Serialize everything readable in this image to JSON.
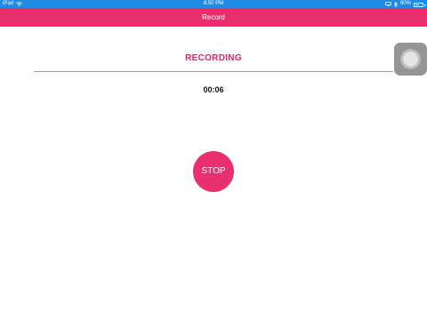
{
  "status_bar": {
    "device": "iPad",
    "time": "8:50 PM",
    "battery_percent": "60%",
    "battery_level": 0.6,
    "bar_color": "#1f8be3"
  },
  "nav": {
    "title": "Record",
    "bar_color": "#e8306e"
  },
  "recorder": {
    "status_label": "RECORDING",
    "elapsed_time": "00:06",
    "stop_label": "STOP",
    "accent_color": "#e8306e"
  },
  "icons": [
    "wifi-icon",
    "airplay-icon",
    "bluetooth-icon",
    "battery-icon",
    "assistive-touch-icon"
  ]
}
